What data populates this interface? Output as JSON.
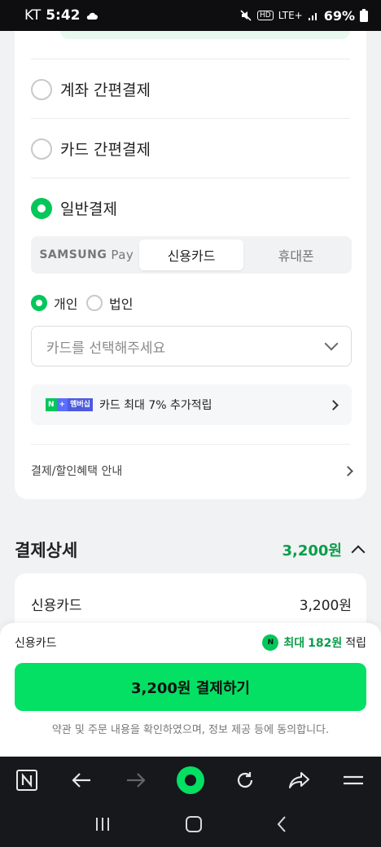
{
  "status": {
    "carrier": "KT",
    "time": "5:42",
    "signal": "LTE+",
    "battery": "69%"
  },
  "payment_methods": [
    {
      "label": "계좌 간편결제",
      "selected": false
    },
    {
      "label": "카드 간편결제",
      "selected": false
    },
    {
      "label": "일반결제",
      "selected": true
    }
  ],
  "tabs": {
    "samsung": "SAMSUNG",
    "samsung_pay": "Pay",
    "credit": "신용카드",
    "phone": "휴대폰",
    "active": "신용카드"
  },
  "entity": {
    "personal": "개인",
    "corporate": "법인",
    "selected": "개인"
  },
  "card_select": {
    "placeholder": "카드를 선택해주세요"
  },
  "promo": {
    "badge_n": "N",
    "badge_plus": "+",
    "badge_member": "멤버십",
    "text": "카드 최대 7% 추가적립"
  },
  "info": {
    "label": "결제/할인혜택 안내"
  },
  "detail": {
    "title": "결제상세",
    "amount": "3,200원",
    "row_label": "신용카드",
    "row_value": "3,200원"
  },
  "sheet": {
    "method": "신용카드",
    "npay": "N",
    "max_label": "최대",
    "points": "182원",
    "earn": "적립",
    "button": "3,200원 결제하기",
    "agree": "약관 및 주문 내용을 확인하였으며, 정보 제공 등에 동의합니다."
  },
  "colors": {
    "accent": "#03c75a",
    "button": "#03e063",
    "amount": "#0a9e4a"
  },
  "toolbar_icons": [
    "naver-n-icon",
    "back-arrow-icon",
    "forward-arrow-icon",
    "home-circle-icon",
    "refresh-icon",
    "share-icon",
    "menu-icon"
  ],
  "navbar_icons": [
    "recent-apps-icon",
    "home-icon",
    "back-icon"
  ]
}
